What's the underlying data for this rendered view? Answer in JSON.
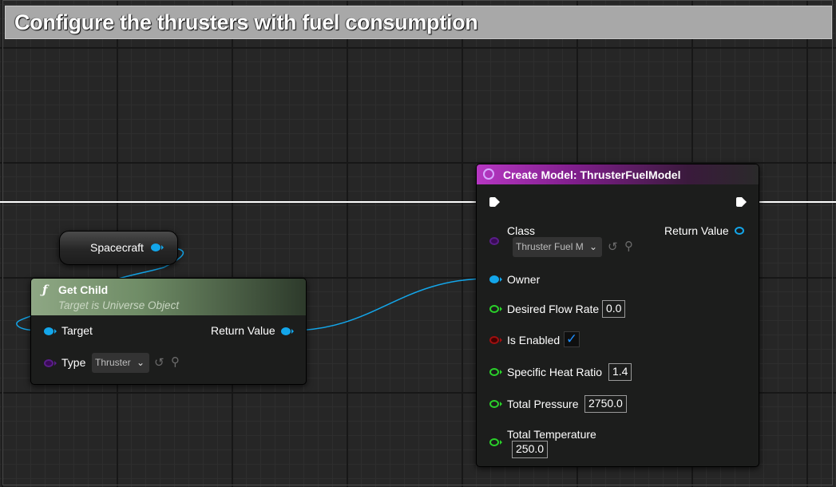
{
  "comment": {
    "title": "Configure the thrusters with fuel consumption"
  },
  "spacecraft_node": {
    "label": "Spacecraft"
  },
  "get_child_node": {
    "title": "Get Child",
    "subtitle": "Target is Universe Object",
    "function_icon": "function-icon",
    "pins": {
      "target": "Target",
      "return_value": "Return Value",
      "type": "Type"
    },
    "type_value": "Thruster"
  },
  "create_model_node": {
    "title": "Create Model: ThrusterFuelModel",
    "icon": "create-model-icon",
    "class_label": "Class",
    "class_value": "Thruster Fuel M",
    "return_value_label": "Return Value",
    "owner_label": "Owner",
    "desired_flow_rate": {
      "label": "Desired Flow Rate",
      "value": "0.0"
    },
    "is_enabled": {
      "label": "Is Enabled",
      "checked": true
    },
    "specific_heat_ratio": {
      "label": "Specific Heat Ratio",
      "value": "1.4"
    },
    "total_pressure": {
      "label": "Total Pressure",
      "value": "2750.0"
    },
    "total_temperature": {
      "label": "Total Temperature",
      "value": "250.0"
    }
  },
  "colors": {
    "object_pin": "#13a6ea",
    "class_pin": "#5a1e89",
    "float_pin": "#2ad12a",
    "bool_pin": "#a01010",
    "create_model_header": "#9e2aa8",
    "get_child_header": "#7f9a74"
  }
}
